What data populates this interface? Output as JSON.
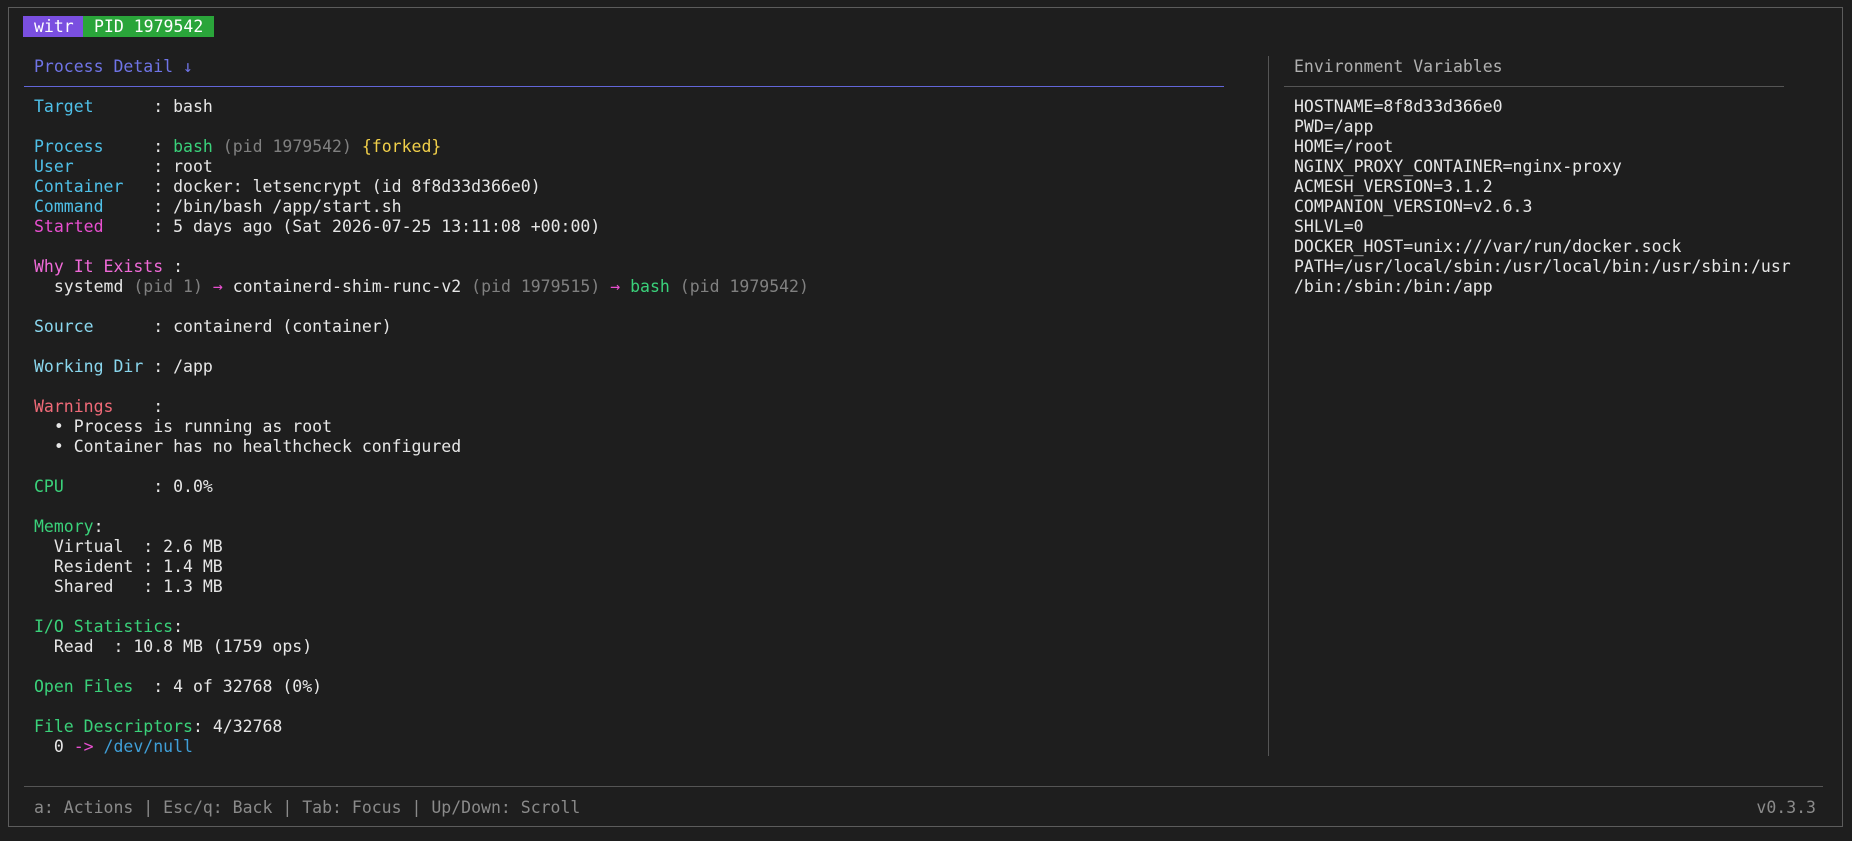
{
  "header": {
    "app_tag": "witr",
    "pid_tag": "PID 1979542"
  },
  "left_panel": {
    "title": "Process Detail ↓",
    "target": {
      "label": "Target      ",
      "sep": ": ",
      "value": "bash"
    },
    "process": {
      "label": "Process     ",
      "sep": ": ",
      "name": "bash",
      "open": " (",
      "pid_text": "pid 1979542",
      "close": ") ",
      "forked": "{forked}"
    },
    "user": {
      "label": "User        ",
      "sep": ": ",
      "value": "root"
    },
    "container": {
      "label": "Container   ",
      "sep": ": ",
      "value": "docker: letsencrypt (id 8f8d33d366e0)"
    },
    "command": {
      "label": "Command     ",
      "sep": ": ",
      "value": "/bin/bash /app/start.sh"
    },
    "started": {
      "label": "Started     ",
      "sep": ": ",
      "value": "5 days ago (Sat 2026-07-25 13:11:08 +00:00)"
    },
    "why": {
      "label": "Why It Exists",
      "sep": " :",
      "chain": {
        "indent": "  ",
        "n1": "systemd",
        "p1_open": " (",
        "p1": "pid 1",
        "p1_close": ") ",
        "arrow1": "→",
        "n2": " containerd-shim-runc-v2",
        "p2_open": " (",
        "p2": "pid 1979515",
        "p2_close": ") ",
        "arrow2": "→",
        "n3": " bash",
        "p3_open": " (",
        "p3": "pid 1979542",
        "p3_close": ")"
      }
    },
    "source": {
      "label": "Source      ",
      "sep": ": ",
      "value": "containerd (container)"
    },
    "working_dir": {
      "label": "Working Dir ",
      "sep": ": ",
      "value": "/app"
    },
    "warnings": {
      "label": "Warnings    ",
      "sep": ":",
      "items": [
        "  • Process is running as root",
        "  • Container has no healthcheck configured"
      ]
    },
    "cpu": {
      "label": "CPU         ",
      "sep": ": ",
      "value": "0.0%"
    },
    "memory": {
      "label": "Memory",
      "sep": ":",
      "rows": [
        "  Virtual  : 2.6 MB",
        "  Resident : 1.4 MB",
        "  Shared   : 1.3 MB"
      ]
    },
    "io": {
      "label": "I/O Statistics",
      "sep": ":",
      "rows": [
        "  Read  : 10.8 MB (1759 ops)"
      ]
    },
    "open_files": {
      "label": "Open Files  ",
      "sep": ": ",
      "value": "4 of 32768 (0%)"
    },
    "fds": {
      "label": "File Descriptors",
      "sep": ": ",
      "value": "4/32768",
      "entry": {
        "fd": "  0 ",
        "arrow": "->",
        "path": " /dev/null"
      }
    }
  },
  "right_panel": {
    "title": "Environment Variables",
    "lines": [
      "HOSTNAME=8f8d33d366e0",
      "PWD=/app",
      "HOME=/root",
      "NGINX_PROXY_CONTAINER=nginx-proxy",
      "ACMESH_VERSION=3.1.2",
      "COMPANION_VERSION=v2.6.3",
      "SHLVL=0",
      "DOCKER_HOST=unix:///var/run/docker.sock",
      "PATH=/usr/local/sbin:/usr/local/bin:/usr/sbin:/usr",
      "/bin:/sbin:/bin:/app"
    ]
  },
  "footer": {
    "help": "a: Actions | Esc/q: Back | Tab: Focus | Up/Down: Scroll",
    "version": "v0.3.3"
  }
}
